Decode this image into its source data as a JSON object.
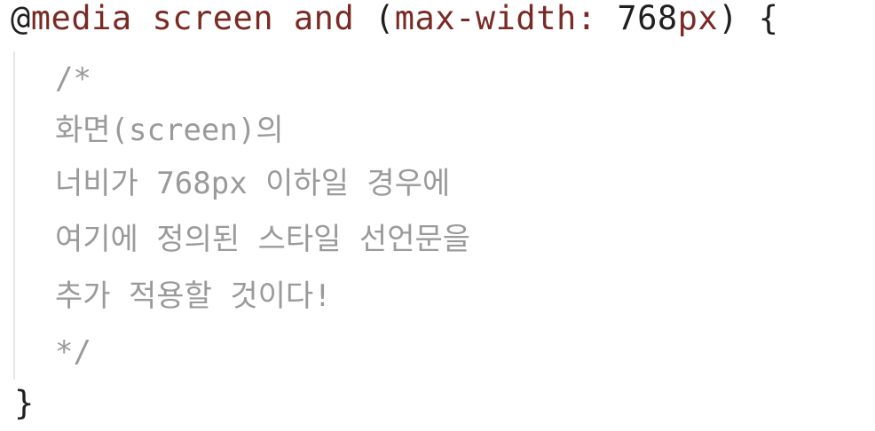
{
  "code": {
    "media_rule": {
      "at_symbol": "@",
      "keyword": "media",
      "media_type": "screen",
      "operator": "and",
      "open_paren": "(",
      "feature": "max-width:",
      "value_number": "768",
      "value_unit": "px",
      "close_paren_brace": ") {"
    },
    "comment_lines": [
      "/*",
      "화면(screen)의",
      "너비가 768px 이하일 경우에",
      "여기에 정의된 스타일 선언문을",
      "추가 적용할 것이다!",
      "*/"
    ],
    "closing_brace": "}"
  },
  "colors": {
    "keyword": "#7a2a25",
    "plain": "#1f1f1f",
    "comment": "#9a9a9a",
    "indent_guide": "#e6e6e6",
    "background": "#ffffff"
  }
}
